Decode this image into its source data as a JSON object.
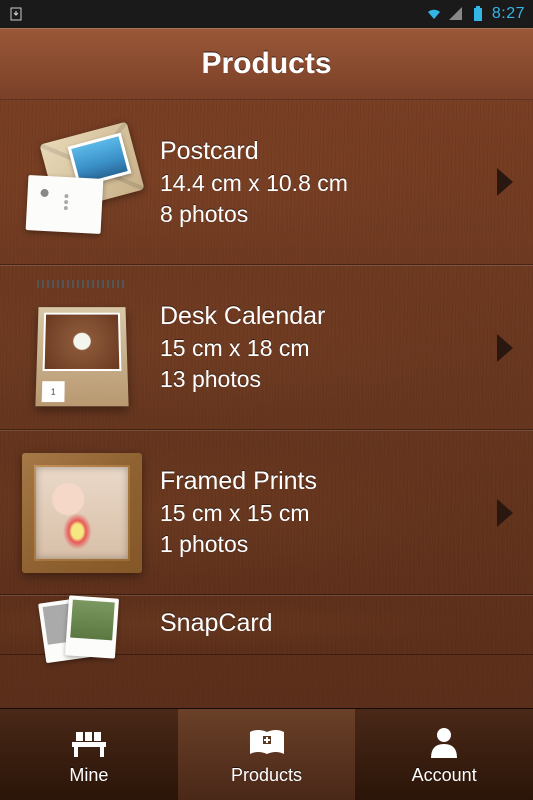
{
  "statusbar": {
    "time": "8:27"
  },
  "header": {
    "title": "Products"
  },
  "products": [
    {
      "title": "Postcard",
      "dimensions": "14.4 cm x 10.8 cm",
      "photos": "8 photos"
    },
    {
      "title": "Desk Calendar",
      "dimensions": "15 cm x 18 cm",
      "photos": "13 photos"
    },
    {
      "title": "Framed Prints",
      "dimensions": "15 cm x 15 cm",
      "photos": "1 photos"
    },
    {
      "title": "SnapCard",
      "dimensions": "",
      "photos": ""
    }
  ],
  "tabs": {
    "mine": "Mine",
    "products": "Products",
    "account": "Account"
  }
}
